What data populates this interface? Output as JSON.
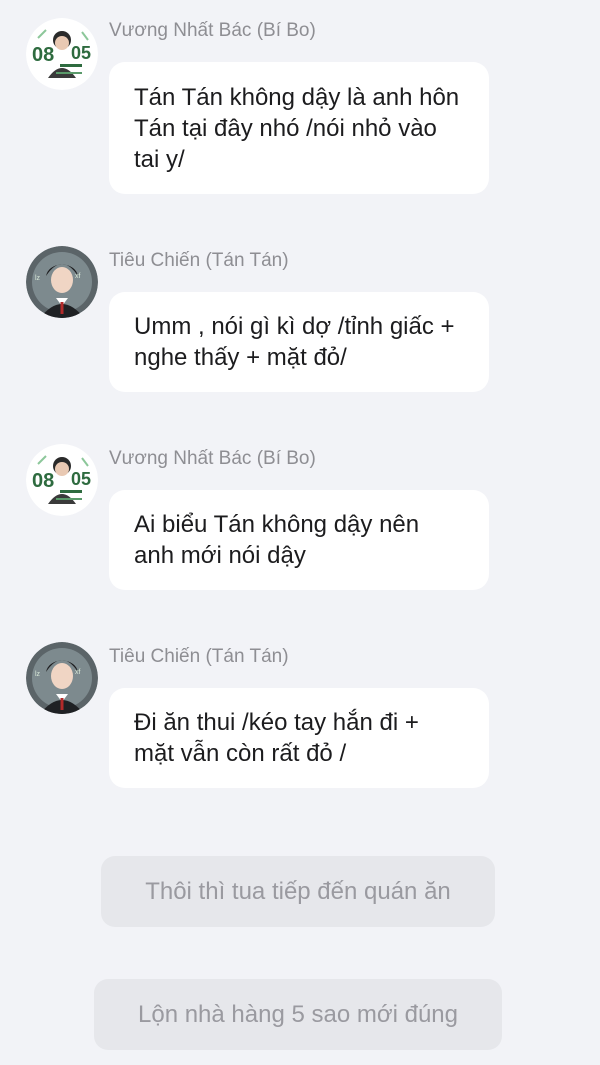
{
  "messages": [
    {
      "sender": "Vương Nhất Bác (Bí Bo)",
      "avatar_icon": "avatar-wang-yibo",
      "text": "Tán Tán không dậy là anh hôn Tán tại đây nhó /nói nhỏ vào tai y/"
    },
    {
      "sender": "Tiêu Chiến (Tán Tán)",
      "avatar_icon": "avatar-xiao-zhan",
      "text": "Umm , nói gì kì dợ /tỉnh giấc + nghe thấy + mặt đỏ/"
    },
    {
      "sender": "Vương Nhất Bác (Bí Bo)",
      "avatar_icon": "avatar-wang-yibo",
      "text": "Ai biểu Tán không dậy nên anh mới nói dậy"
    },
    {
      "sender": "Tiêu Chiến (Tán Tán)",
      "avatar_icon": "avatar-xiao-zhan",
      "text": "Đi ăn thui /kéo tay hắn đi + mặt vẫn còn rất đỏ /"
    }
  ],
  "choices": [
    {
      "label": "Thôi thì tua tiếp đến quán ăn"
    },
    {
      "label": "Lộn nhà hàng 5 sao mới đúng"
    }
  ],
  "colors": {
    "background": "#f2f3f7",
    "bubble": "#ffffff",
    "choice_bg": "#e6e7eb",
    "choice_text": "#9a9aa0",
    "sender_text": "#8e8e93"
  }
}
